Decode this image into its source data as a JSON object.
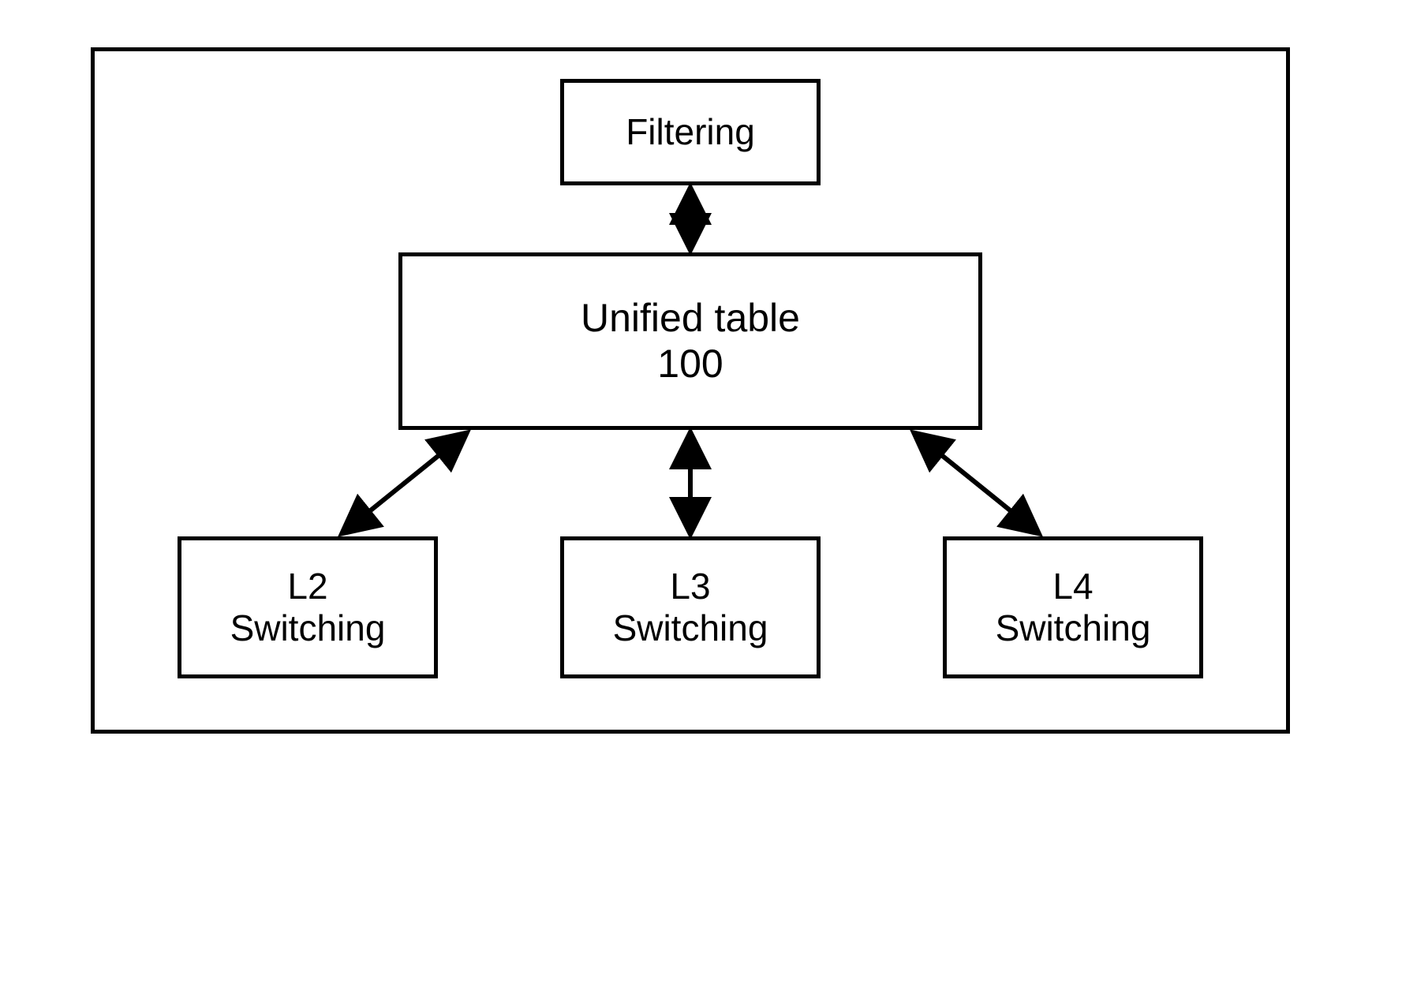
{
  "boxes": {
    "filtering": {
      "label": "Filtering"
    },
    "unified": {
      "line1": "Unified table",
      "line2": "100"
    },
    "l2": {
      "line1": "L2",
      "line2": "Switching"
    },
    "l3": {
      "line1": "L3",
      "line2": "Switching"
    },
    "l4": {
      "line1": "L4",
      "line2": "Switching"
    }
  }
}
